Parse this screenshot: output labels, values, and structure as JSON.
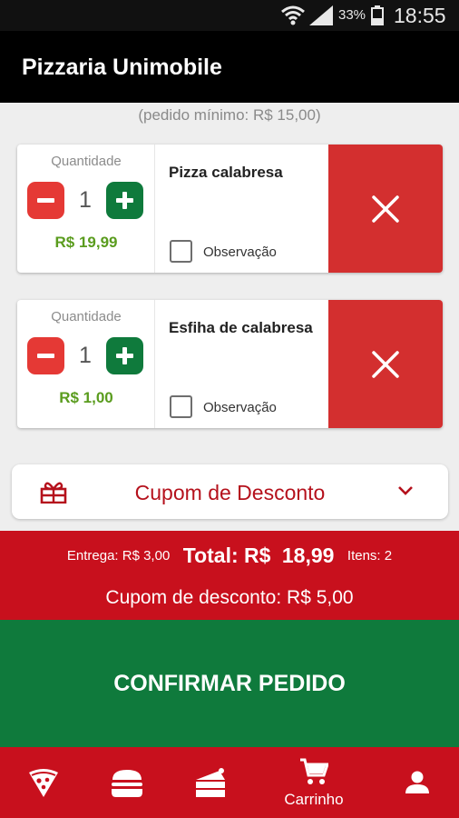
{
  "status_bar": {
    "battery_percent": "33%",
    "time": "18:55",
    "icons": [
      "wifi-icon",
      "signal-icon",
      "battery-icon"
    ]
  },
  "app": {
    "title": "Pizzaria Unimobile"
  },
  "cart": {
    "min_order_note": "(pedido mínimo: R$ 15,00)",
    "quantity_label": "Quantidade",
    "observation_label": "Observação",
    "items": [
      {
        "name": "Pizza calabresa",
        "quantity": "1",
        "price": "R$ 19,99",
        "observation_checked": false
      },
      {
        "name": "Esfiha de calabresa",
        "quantity": "1",
        "price": "R$ 1,00",
        "observation_checked": false
      }
    ]
  },
  "coupon": {
    "label": "Cupom de Desconto",
    "icon": "gift-icon",
    "toggle_icon": "chevron-down-icon"
  },
  "summary": {
    "delivery": "Entrega: R$ 3,00",
    "total_label": "Total: R$",
    "total_value": "18,99",
    "items_count": "Itens: 2",
    "discount": "Cupom de desconto: R$ 5,00"
  },
  "confirm": {
    "label": "CONFIRMAR PEDIDO"
  },
  "bottom_nav": {
    "items": [
      {
        "icon": "pizza-icon"
      },
      {
        "icon": "burger-icon"
      },
      {
        "icon": "cake-icon"
      },
      {
        "icon": "cart-icon",
        "label": "Carrinho"
      },
      {
        "icon": "user-icon"
      }
    ]
  },
  "colors": {
    "brand_red": "#c8101d",
    "confirm_green": "#0f7a3c",
    "remove_red": "#d32f2f",
    "price_green": "#5a9c1e",
    "app_bar": "#000000"
  }
}
